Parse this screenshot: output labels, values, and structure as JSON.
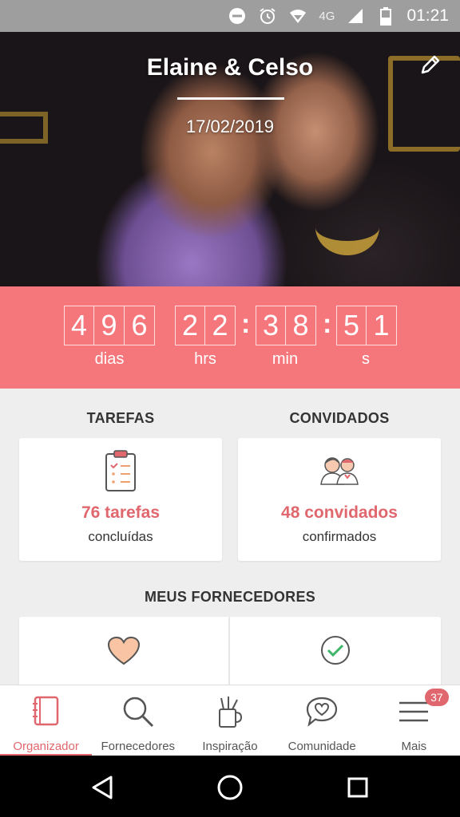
{
  "status_bar": {
    "network": "4G",
    "time": "01:21"
  },
  "hero": {
    "title": "Elaine & Celso",
    "date": "17/02/2019"
  },
  "countdown": {
    "days": [
      "4",
      "9",
      "6"
    ],
    "hours": [
      "2",
      "2"
    ],
    "minutes": [
      "3",
      "8"
    ],
    "seconds": [
      "5",
      "1"
    ],
    "labels": {
      "days": "dias",
      "hours": "hrs",
      "minutes": "min",
      "seconds": "s"
    }
  },
  "tasks": {
    "title": "TAREFAS",
    "count": "76 tarefas",
    "sub": "concluídas"
  },
  "guests": {
    "title": "CONVIDADOS",
    "count": "48 convidados",
    "sub": "confirmados"
  },
  "vendors": {
    "title": "MEUS FORNECEDORES"
  },
  "tabs": [
    {
      "label": "Organizador",
      "icon": "notebook-icon",
      "active": true
    },
    {
      "label": "Fornecedores",
      "icon": "search-icon"
    },
    {
      "label": "Inspiração",
      "icon": "inspiration-icon"
    },
    {
      "label": "Comunidade",
      "icon": "chat-heart-icon"
    },
    {
      "label": "Mais",
      "icon": "menu-icon",
      "badge": "37"
    }
  ],
  "colors": {
    "accent": "#e0676d",
    "countdown_bg": "#f5777c"
  }
}
